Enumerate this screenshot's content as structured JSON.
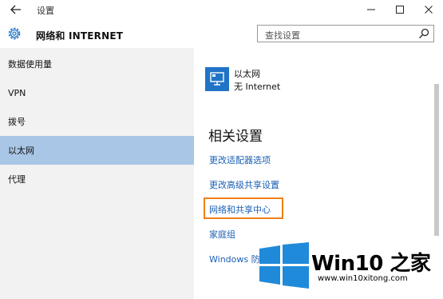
{
  "titlebar": {
    "title": "设置"
  },
  "header": {
    "title": "网络和 INTERNET"
  },
  "search": {
    "placeholder": "查找设置"
  },
  "sidebar": {
    "items": [
      {
        "label": "数据使用量",
        "active": false
      },
      {
        "label": "VPN",
        "active": false
      },
      {
        "label": "拨号",
        "active": false
      },
      {
        "label": "以太网",
        "active": true
      },
      {
        "label": "代理",
        "active": false
      }
    ]
  },
  "main": {
    "connection": {
      "name": "以太网",
      "status": "无 Internet"
    },
    "section_title": "相关设置",
    "links": [
      {
        "label": "更改适配器选项"
      },
      {
        "label": "更改高级共享设置"
      },
      {
        "label": "网络和共享中心",
        "highlighted": true
      },
      {
        "label": "家庭组"
      },
      {
        "label": "Windows 防火墙"
      }
    ]
  },
  "watermark": {
    "brand": "Win10 之家",
    "url": "www.win10xitong.com"
  },
  "colors": {
    "accent": "#1f74c7",
    "sidebar_bg": "#f2f2f2",
    "selected_bg": "#a9c6e6",
    "link": "#1a5fb4",
    "highlight_border": "#f07f17"
  }
}
